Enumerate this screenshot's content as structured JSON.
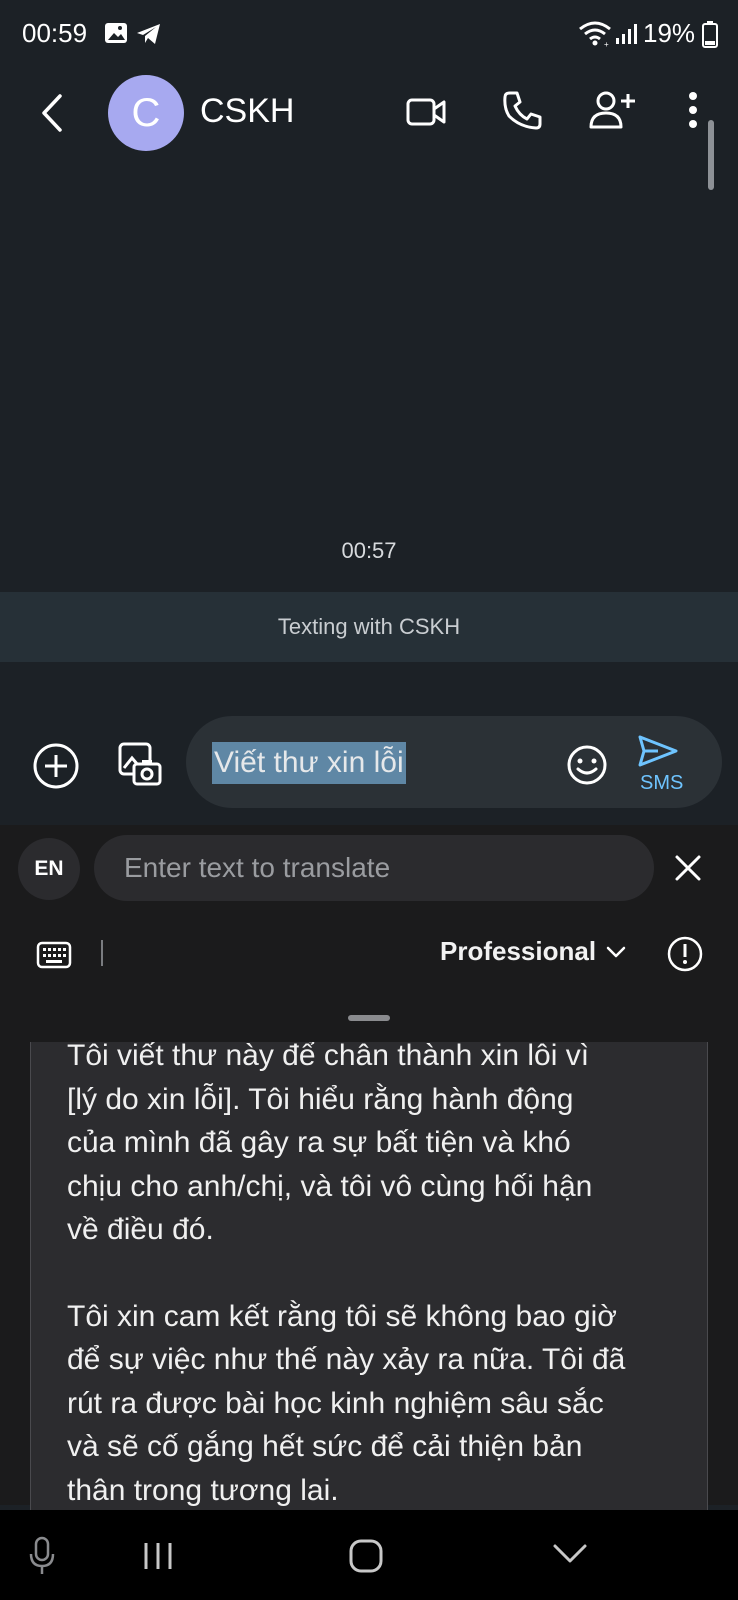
{
  "status_bar": {
    "time": "00:59",
    "battery": "19%",
    "icons": [
      "gallery-icon",
      "telegram-icon",
      "wifi-icon",
      "signal-icon",
      "battery-icon"
    ]
  },
  "header": {
    "avatar_letter": "C",
    "contact_name": "CSKH",
    "actions": [
      "back-icon",
      "video-call-icon",
      "phone-icon",
      "add-person-icon",
      "more-vert-icon"
    ]
  },
  "conversation": {
    "timestamp": "00:57",
    "banner": "Texting with CSKH"
  },
  "composer": {
    "message_text": "Viết thư xin lỗi",
    "send_label": "SMS",
    "accent_color": "#6ec4ff"
  },
  "translate": {
    "language": "EN",
    "placeholder": "Enter text to translate"
  },
  "toolbar": {
    "tone": "Professional"
  },
  "result": {
    "paragraph_1": "Tôi viết thư này để chân thành xin lỗi vì\n[lý do xin lỗi]. Tôi hiểu rằng hành động\ncủa mình đã gây ra sự bất tiện và khó\nchịu cho anh/chị, và tôi vô cùng hối hận\nvề điều đó.",
    "paragraph_2": "Tôi xin cam kết rằng tôi sẽ không bao giờ\nđể sự việc như thế này xảy ra nữa. Tôi đã\nrút ra được bài học kinh nghiệm sâu sắc\nvà sẽ cố gắng hết sức để cải thiện bản\nthân trong tương lai."
  }
}
